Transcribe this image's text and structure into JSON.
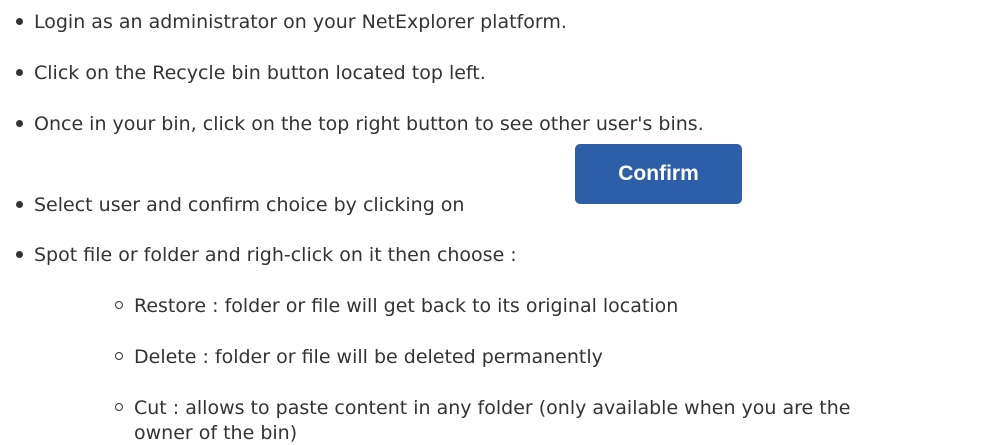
{
  "list": {
    "items": [
      "Login as an administrator on your NetExplorer platform.",
      "Click on the Recycle bin button located top left.",
      "Once in your bin, click on the top right button to see other user's bins.",
      "Select user and confirm choice by clicking on",
      "Spot file or folder and righ-click on it then choose :"
    ],
    "subitems": [
      "Restore : folder or file will get back to its original location",
      "Delete : folder or file will be deleted permanently",
      "Cut : allows to paste content in any folder (only available when you are the",
      "owner of the bin)"
    ]
  },
  "confirm_button": {
    "label": "Confirm",
    "color": "#2d5fa8"
  }
}
